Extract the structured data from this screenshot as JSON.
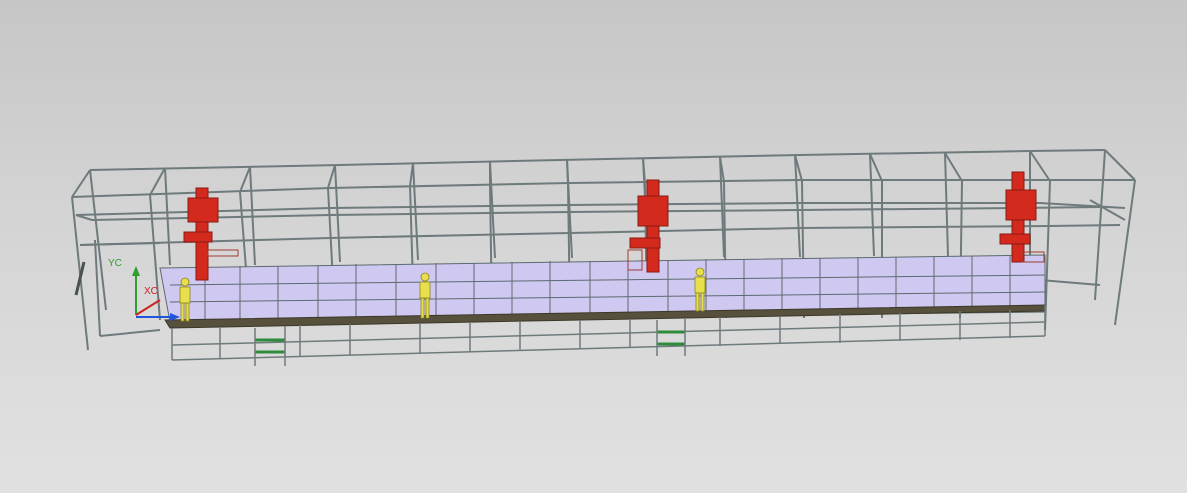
{
  "viewport": {
    "background_top": "#c6c6c6",
    "background_bottom": "#e1e1e1"
  },
  "triad": {
    "y_label": "YC",
    "x_label": "XC",
    "y_color": "#2e9e2e",
    "x_color": "#cc2222",
    "z_color": "#2255dd"
  },
  "model": {
    "frame_color": "#6f7a7d",
    "tank_color": "#cfc8f0",
    "robot_color": "#d42a1e",
    "operator_color": "#e8e04a",
    "walkway_color": "#56503c",
    "step_color": "#2e8b3a"
  }
}
